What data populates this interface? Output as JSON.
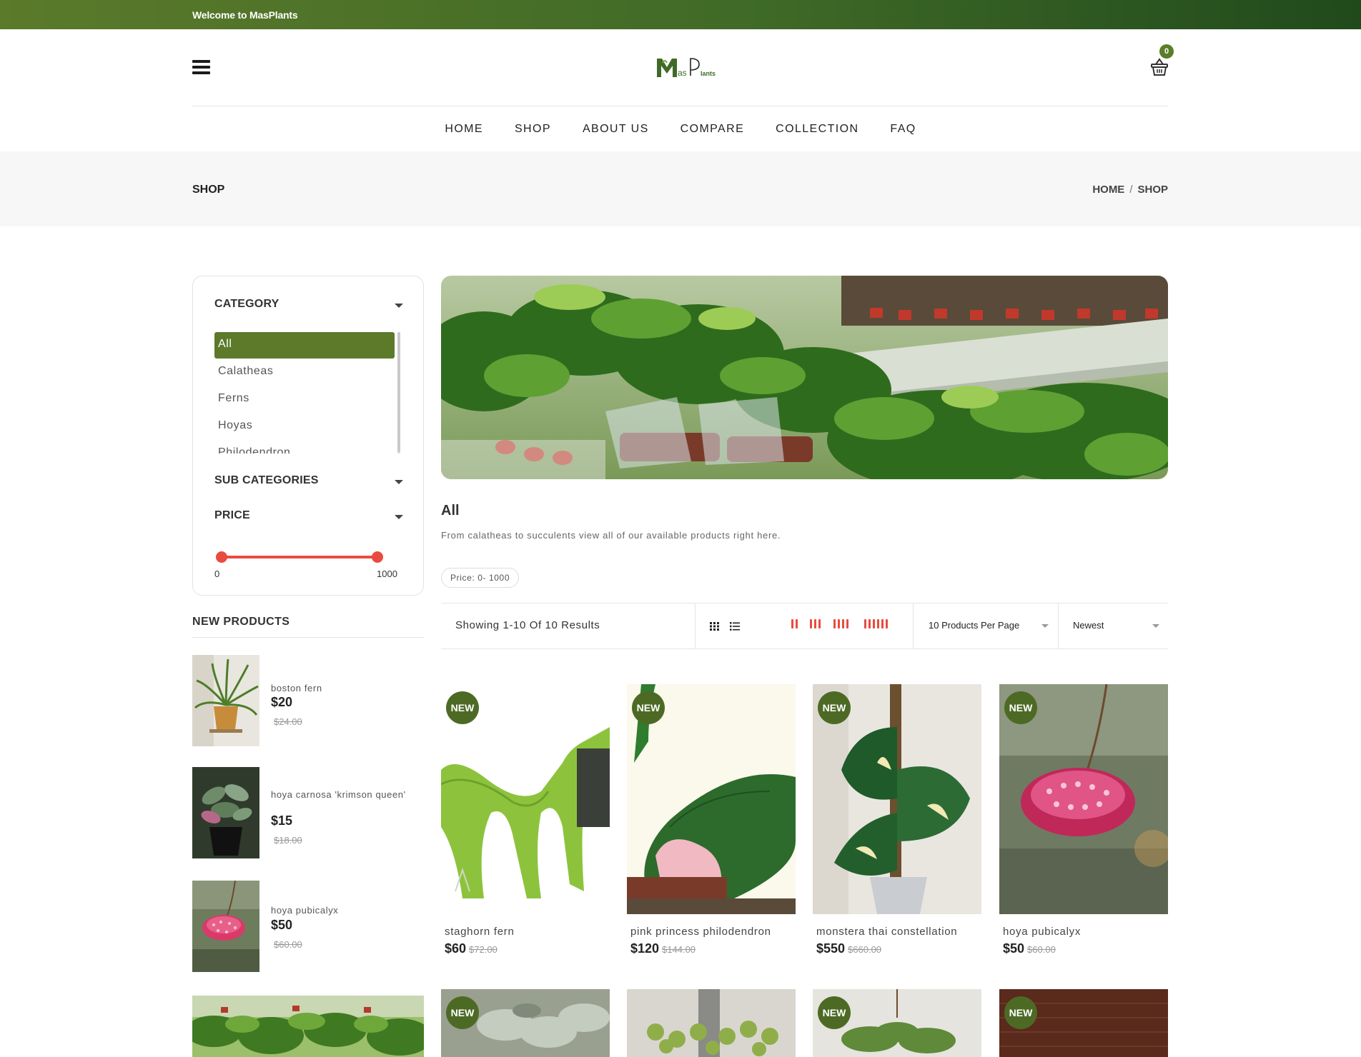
{
  "topbar": {
    "welcome": "Welcome to MasPlants"
  },
  "header": {
    "logo_text": "MasPlants",
    "cart_count": "0",
    "accent_color": "#5c7a2a"
  },
  "nav": [
    "HOME",
    "SHOP",
    "ABOUT US",
    "COMPARE",
    "COLLECTION",
    "FAQ"
  ],
  "breadcrumb": {
    "title": "SHOP",
    "items": [
      "HOME",
      "SHOP"
    ],
    "separator": "/"
  },
  "sidebar": {
    "category": {
      "title": "CATEGORY",
      "items": [
        "All",
        "Calatheas",
        "Ferns",
        "Hoyas",
        "Philodendron"
      ],
      "selected": "All"
    },
    "subcategories": {
      "title": "SUB CATEGORIES"
    },
    "price": {
      "title": "PRICE",
      "min": "0",
      "max": "1000"
    },
    "new_products": {
      "title": "NEW PRODUCTS",
      "items": [
        {
          "name": "boston fern",
          "price": "$20",
          "old_price": "$24.00"
        },
        {
          "name": "hoya carnosa 'krimson queen'",
          "price": "$15",
          "old_price": "$18.00"
        },
        {
          "name": "hoya pubicalyx",
          "price": "$50",
          "old_price": "$60.00"
        }
      ]
    }
  },
  "main": {
    "category_title": "All",
    "category_description": "From calatheas to succulents view all of our available products right here.",
    "price_filter_chip": "Price: 0- 1000",
    "toolbar": {
      "results": "Showing 1-10 Of 10 Results",
      "per_page": "10 Products Per Page",
      "sort": "Newest"
    },
    "products": [
      {
        "badge": "NEW",
        "name": "staghorn fern",
        "price": "$60",
        "old_price": "$72.00"
      },
      {
        "badge": "NEW",
        "name": "pink princess philodendron",
        "price": "$120",
        "old_price": "$144.00"
      },
      {
        "badge": "NEW",
        "name": "monstera thai constellation",
        "price": "$550",
        "old_price": "$660.00"
      },
      {
        "badge": "NEW",
        "name": "hoya pubicalyx",
        "price": "$50",
        "old_price": "$60.00"
      }
    ],
    "row2_badges": [
      "NEW",
      "",
      "NEW",
      "NEW"
    ]
  }
}
